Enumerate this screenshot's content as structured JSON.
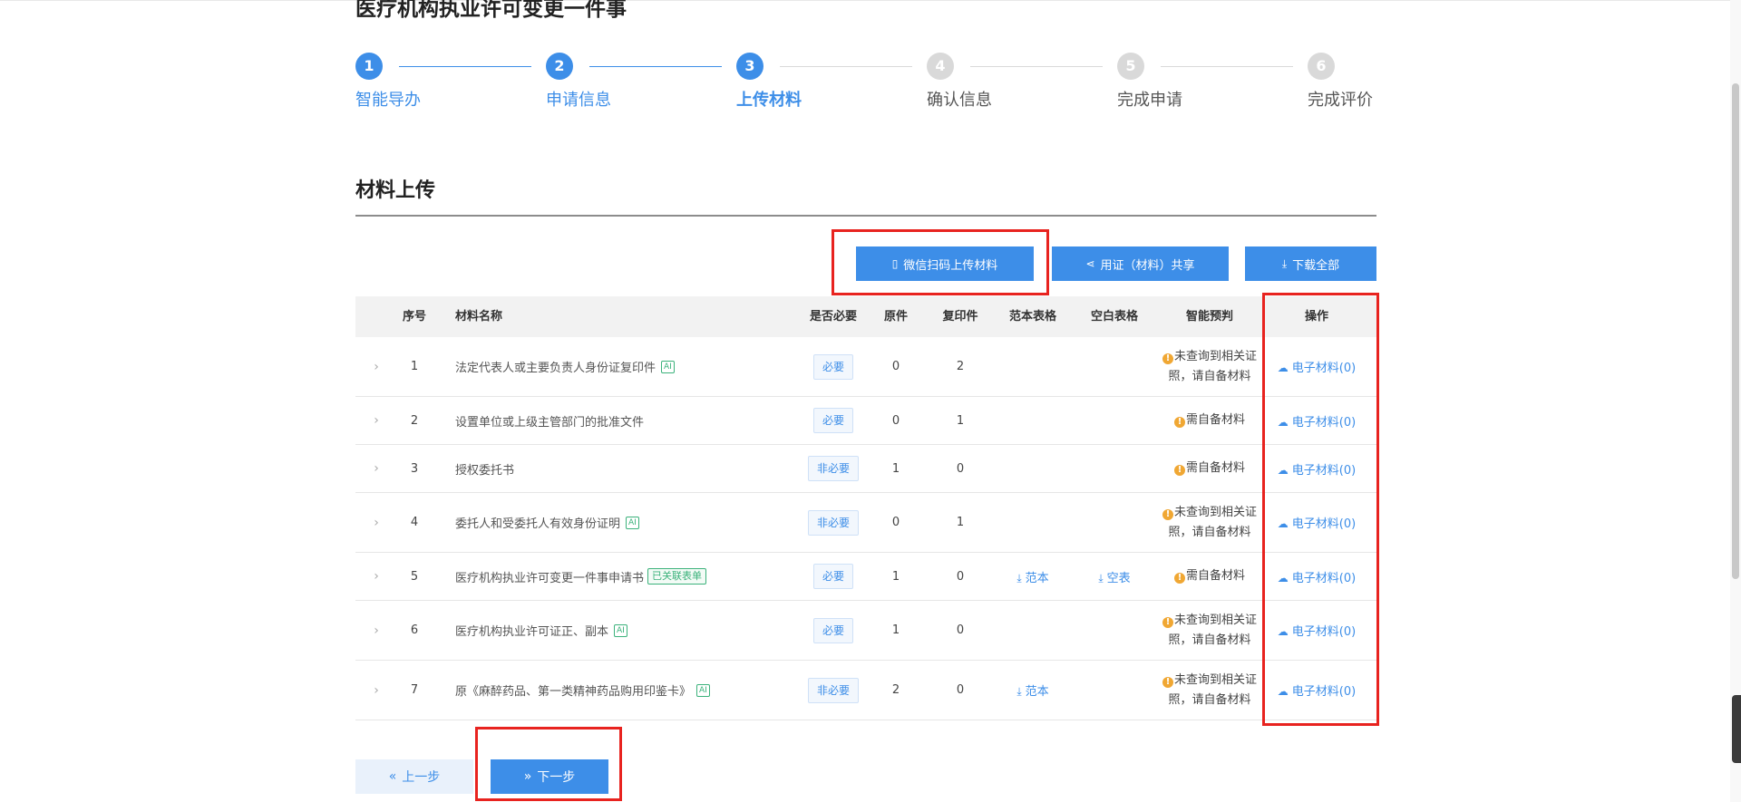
{
  "page": {
    "title": "医疗机构执业许可变更一件事"
  },
  "steps": [
    {
      "num": "1",
      "label": "智能导办",
      "state": "done"
    },
    {
      "num": "2",
      "label": "申请信息",
      "state": "done"
    },
    {
      "num": "3",
      "label": "上传材料",
      "state": "active"
    },
    {
      "num": "4",
      "label": "确认信息",
      "state": "todo"
    },
    {
      "num": "5",
      "label": "完成申请",
      "state": "todo"
    },
    {
      "num": "6",
      "label": "完成评价",
      "state": "todo"
    }
  ],
  "section": {
    "title": "材料上传"
  },
  "actions": {
    "wechat_upload": "微信扫码上传材料",
    "share": "用证（材料）共享",
    "download_all": "下载全部"
  },
  "table": {
    "headers": {
      "index": "序号",
      "name": "材料名称",
      "required": "是否必要",
      "original": "原件",
      "copy": "复印件",
      "sample_form": "范本表格",
      "blank_form": "空白表格",
      "smart_check": "智能预判",
      "operation": "操作"
    },
    "rows": [
      {
        "index": "1",
        "name": "法定代表人或主要负责人身份证复印件",
        "tag": "AI",
        "form_tag": "",
        "required": "必要",
        "original": "0",
        "copy": "2",
        "sample": "",
        "blank": "",
        "judge_line1": "未查询到相关证",
        "judge_line2": "照，请自备材料",
        "op": "电子材料(0)"
      },
      {
        "index": "2",
        "name": "设置单位或上级主管部门的批准文件",
        "tag": "",
        "form_tag": "",
        "required": "必要",
        "original": "0",
        "copy": "1",
        "sample": "",
        "blank": "",
        "judge_line1": "需自备材料",
        "judge_line2": "",
        "op": "电子材料(0)"
      },
      {
        "index": "3",
        "name": "授权委托书",
        "tag": "",
        "form_tag": "",
        "required": "非必要",
        "original": "1",
        "copy": "0",
        "sample": "",
        "blank": "",
        "judge_line1": "需自备材料",
        "judge_line2": "",
        "op": "电子材料(0)"
      },
      {
        "index": "4",
        "name": "委托人和受委托人有效身份证明",
        "tag": "AI",
        "form_tag": "",
        "required": "非必要",
        "original": "0",
        "copy": "1",
        "sample": "",
        "blank": "",
        "judge_line1": "未查询到相关证",
        "judge_line2": "照，请自备材料",
        "op": "电子材料(0)"
      },
      {
        "index": "5",
        "name": "医疗机构执业许可变更一件事申请书",
        "tag": "",
        "form_tag": "已关联表单",
        "required": "必要",
        "original": "1",
        "copy": "0",
        "sample": "范本",
        "blank": "空表",
        "judge_line1": "需自备材料",
        "judge_line2": "",
        "op": "电子材料(0)"
      },
      {
        "index": "6",
        "name": "医疗机构执业许可证正、副本",
        "tag": "AI",
        "form_tag": "",
        "required": "必要",
        "original": "1",
        "copy": "0",
        "sample": "",
        "blank": "",
        "judge_line1": "未查询到相关证",
        "judge_line2": "照，请自备材料",
        "op": "电子材料(0)"
      },
      {
        "index": "7",
        "name": "原《麻醉药品、第一类精神药品购用印鉴卡》",
        "tag": "AI",
        "form_tag": "",
        "required": "非必要",
        "original": "2",
        "copy": "0",
        "sample": "范本",
        "blank": "",
        "judge_line1": "未查询到相关证",
        "judge_line2": "照，请自备材料",
        "op": "电子材料(0)"
      }
    ]
  },
  "nav": {
    "prev": "上一步",
    "next": "下一步"
  },
  "colors": {
    "primary": "#3d8ee8",
    "highlight": "#e8231f",
    "warning": "#f0a733",
    "tag_green": "#3bb27b"
  },
  "icons": {
    "wechat": "mobile-phone-icon",
    "share": "share-icon",
    "download": "download-icon",
    "upload": "cloud-upload-icon",
    "warning": "warning-icon",
    "expand": "chevron-right-icon",
    "prev": "double-chevron-left-icon",
    "next": "double-chevron-right-icon"
  }
}
